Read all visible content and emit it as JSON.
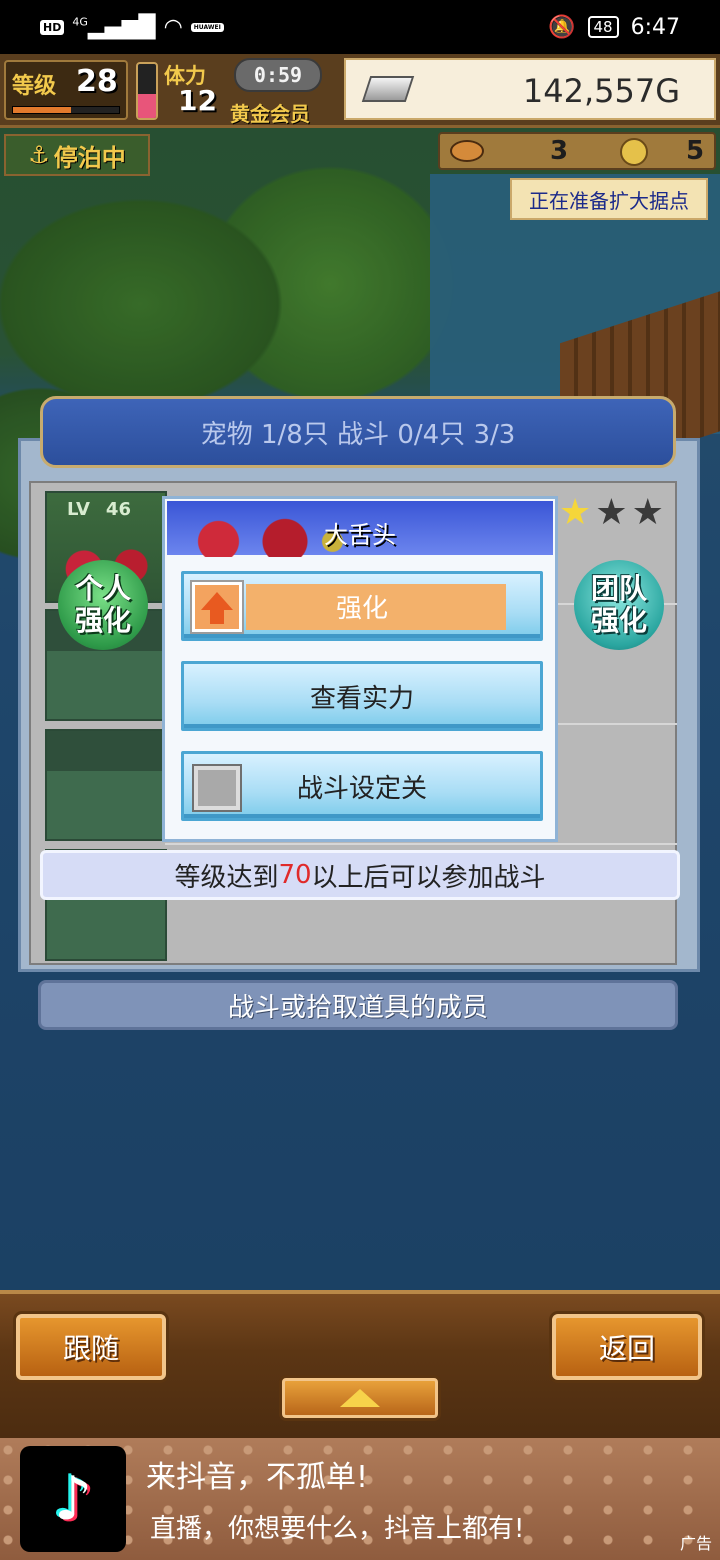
{
  "status_bar": {
    "hd": "HD",
    "network": "4G",
    "carrier_badge": "HUAWEI",
    "battery": "48",
    "time": "6:47"
  },
  "hud": {
    "level_label": "等级",
    "level_value": "28",
    "level_progress": 0.55,
    "stamina_label": "体力",
    "stamina_value": "12",
    "stamina_fill": 0.45,
    "timer": "0:59",
    "membership": "黄金会员",
    "money": "142,557G",
    "anchor_status": "停泊中",
    "fish_count": "3",
    "coin_count": "5",
    "expand_notice": "正在准备扩大据点"
  },
  "pet_panel": {
    "header": "宠物 1/8只 战斗 0/4只  3/3",
    "slot_lv_label": "LV",
    "slot_lv_value": "46",
    "stars_total": 3,
    "stars_filled": 1,
    "personal_btn": [
      "个人",
      "强化"
    ],
    "team_btn": [
      "团队",
      "强化"
    ]
  },
  "popup": {
    "pet_name": "大舌头",
    "enhance_label": "强化",
    "view_strength_label": "查看实力",
    "battery_toggle_label": "战斗设定关"
  },
  "notice": {
    "prefix": "等级达到",
    "number": "70",
    "suffix": "以上后可以参加战斗"
  },
  "members_label": "战斗或拾取道具的成员",
  "bottom": {
    "follow_label": "跟随",
    "back_label": "返回"
  },
  "ad": {
    "title": "来抖音，不孤单!",
    "subtitle": "直播，你想要什么，抖音上都有!",
    "tag": "广告"
  },
  "colors": {
    "accent_blue": "#2c4f9c",
    "enhance_orange": "#f3b16b",
    "notice_red": "#e02a2a",
    "wood": "#5c3614"
  }
}
